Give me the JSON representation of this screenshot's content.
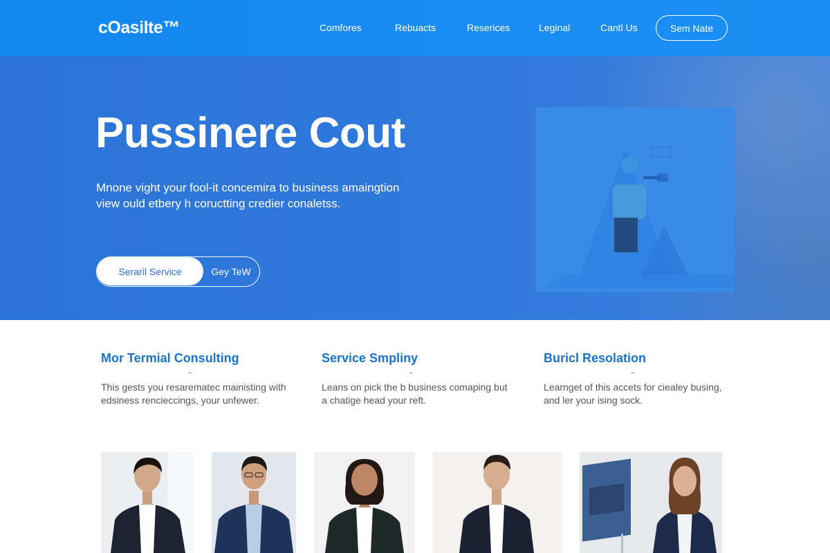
{
  "nav": {
    "logo": "cOasilte™",
    "links": [
      "Comfores",
      "Rebuacts",
      "Reserices",
      "Leginal",
      "Cantl Us"
    ],
    "cta": "Sem Nate"
  },
  "hero": {
    "title": "Pussinere Cout",
    "subtitle_line1": "Mnone vight your fool-it concemira to business amaingtion",
    "subtitle_line2": "view ould etbery h coructting credier conaletss.",
    "primary_button": "Seraril Service",
    "secondary_button": "Gey TeW"
  },
  "features": [
    {
      "title": "Mor Termial Consulting",
      "mark": "~",
      "text_line1": "This gests you resarematec mainisting with",
      "text_line2": "edsiness rencieccings, your unfewer."
    },
    {
      "title": "Service Smpliny",
      "mark": "~",
      "text_line1": "Leans on pick the b business comaping but",
      "text_line2": "a chatige head your reft."
    },
    {
      "title": "Buricl Resolation",
      "mark": "~",
      "text_line1": "Learnget of this accets for ciealey busing,",
      "text_line2": "and ler your ising sock."
    }
  ],
  "colors": {
    "nav_bg": "#1187ef",
    "hero_bg": "#2c74d8",
    "feature_title": "#1b72c9"
  }
}
